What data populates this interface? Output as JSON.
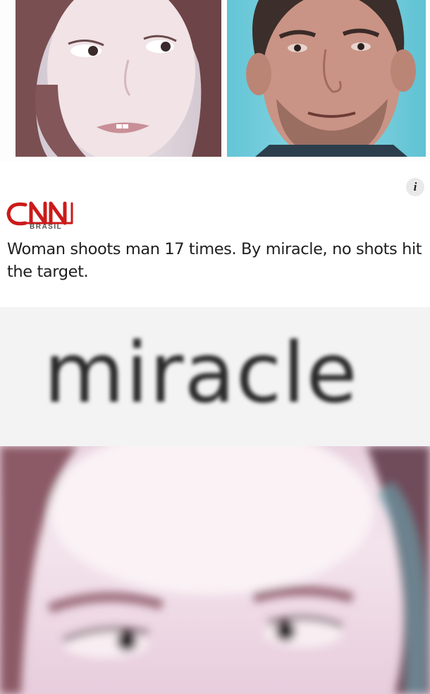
{
  "brand": {
    "name": "CNN",
    "region": "BRASIL"
  },
  "headline": "Woman shoots man 17 times. By miracle, no shots hit the target.",
  "caption": "miracle",
  "info_icon": "i",
  "colors": {
    "brand_red": "#cc0000",
    "photo_bg": "#7fd1de",
    "text": "#1f1f1f"
  }
}
